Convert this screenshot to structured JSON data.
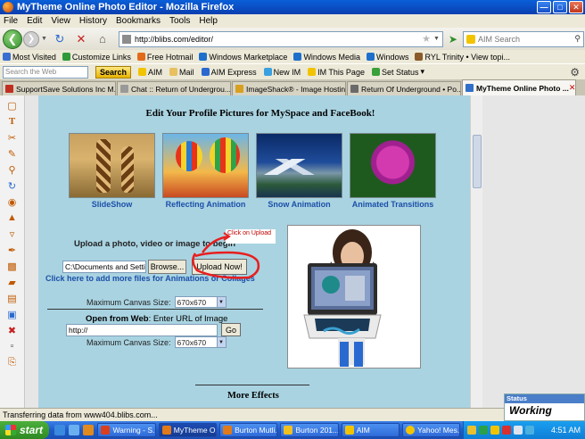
{
  "window": {
    "title": "MyTheme Online Photo Editor - Mozilla Firefox"
  },
  "menu": [
    "File",
    "Edit",
    "View",
    "History",
    "Bookmarks",
    "Tools",
    "Help"
  ],
  "nav": {
    "url": "http://blibs.com/editor/",
    "search_placeholder": "AIM Search"
  },
  "bookmarks": [
    {
      "label": "Most Visited",
      "color": "#3a6ed0"
    },
    {
      "label": "Customize Links",
      "color": "#2e9a3a"
    },
    {
      "label": "Free Hotmail",
      "color": "#e26a1a"
    },
    {
      "label": "Windows Marketplace",
      "color": "#1e6fcc"
    },
    {
      "label": "Windows Media",
      "color": "#1e6fcc"
    },
    {
      "label": "Windows",
      "color": "#1e6fcc"
    },
    {
      "label": "RYL Trinity • View topi...",
      "color": "#8a5a2a"
    }
  ],
  "aimbar": {
    "search_placeholder": "Search the Web",
    "search_button": "Search",
    "items": [
      "AIM",
      "Mail",
      "AIM Express",
      "New IM",
      "IM This Page",
      "Set Status"
    ]
  },
  "tabs": [
    {
      "label": "SupportSave Solutions Inc M...",
      "active": false,
      "color": "#c03020"
    },
    {
      "label": "Chat :: Return of Undergrou...",
      "active": false,
      "color": "#999999"
    },
    {
      "label": "ImageShack® - Image Hosting",
      "active": false,
      "color": "#d8a020"
    },
    {
      "label": "Return Of Underground • Po...",
      "active": false,
      "color": "#6a6a6a"
    },
    {
      "label": "MyTheme Online Photo ...",
      "active": true,
      "color": "#3070c8"
    }
  ],
  "editor": {
    "heading": "Edit Your Profile Pictures for MySpace and FaceBook!",
    "effects": [
      {
        "caption": "SlideShow",
        "image": "giraffes"
      },
      {
        "caption": "Reflecting Animation",
        "image": "hot-air-balloons"
      },
      {
        "caption": "Snow Animation",
        "image": "snowy-mountain-lake"
      },
      {
        "caption": "Animated Transitions",
        "image": "purple-flower"
      }
    ],
    "upload_label": "Upload a photo, video or image to begin",
    "file_path": "C:\\Documents and Setti",
    "browse_button": "Browse...",
    "upload_button": "Upload Now!",
    "annotation": "Click on Upload",
    "more_files_link": "Click here to add more files for Animations or Collages",
    "canvas_label": "Maximum Canvas Size:",
    "canvas_size": "670x670",
    "open_web_bold": "Open from Web",
    "open_web_rest": ": Enter URL of Image",
    "url_value": "http://",
    "go_button": "Go",
    "more_effects": "More Effects"
  },
  "statusbar": {
    "text": "Transferring data from www404.blibs.com..."
  },
  "status_widget": {
    "title": "Status",
    "value": "Working"
  },
  "taskbar": {
    "start": "start",
    "tasks": [
      {
        "label": "Warning - S...",
        "active": false,
        "color": "#d84020"
      },
      {
        "label": "MyTheme O...",
        "active": true,
        "color": "#e07a1a"
      },
      {
        "label": "Burton Mutli...",
        "active": false,
        "color": "#e07a1a"
      },
      {
        "label": "Burton 201...",
        "active": false,
        "color": "#f0c020"
      },
      {
        "label": "AIM",
        "active": false,
        "color": "#f2c400"
      },
      {
        "label": "Yahoo! Mes...",
        "active": false,
        "color": "#f2c400"
      }
    ],
    "clock": "4:51 AM"
  }
}
